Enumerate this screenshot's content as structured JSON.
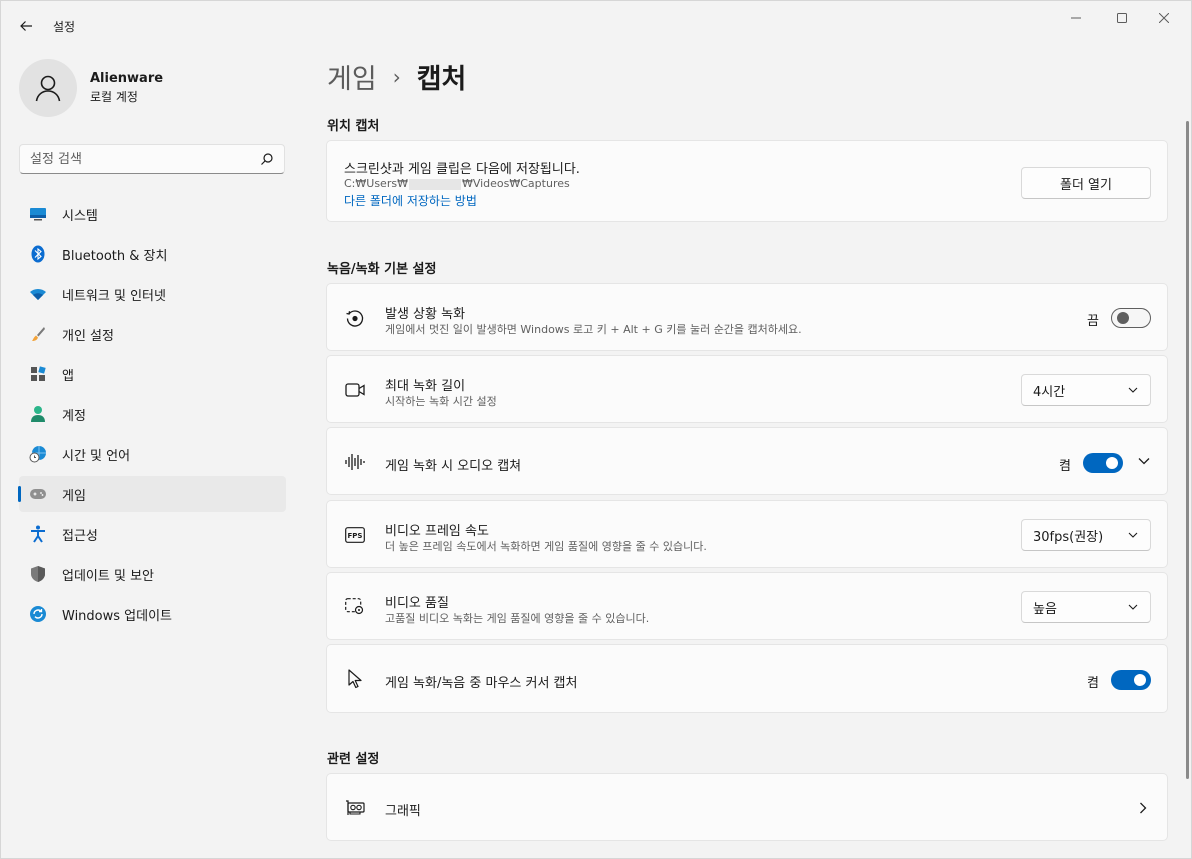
{
  "window": {
    "app_title": "설정"
  },
  "profile": {
    "name": "Alienware",
    "account_type": "로컬 계정"
  },
  "search": {
    "placeholder": "설정 검색"
  },
  "sidebar": {
    "items": [
      {
        "label": "시스템",
        "icon": "system-icon"
      },
      {
        "label": "Bluetooth & 장치",
        "icon": "bluetooth-icon"
      },
      {
        "label": "네트워크 및 인터넷",
        "icon": "wifi-icon"
      },
      {
        "label": "개인 설정",
        "icon": "brush-icon"
      },
      {
        "label": "앱",
        "icon": "apps-icon"
      },
      {
        "label": "계정",
        "icon": "account-icon"
      },
      {
        "label": "시간 및 언어",
        "icon": "globe-clock-icon"
      },
      {
        "label": "게임",
        "icon": "gamepad-icon",
        "active": true
      },
      {
        "label": "접근성",
        "icon": "accessibility-icon"
      },
      {
        "label": "업데이트 및 보안",
        "icon": "shield-icon"
      },
      {
        "label": "Windows 업데이트",
        "icon": "update-icon"
      }
    ]
  },
  "breadcrumb": {
    "parent": "게임",
    "separator": "›",
    "current": "캡처"
  },
  "capture_location": {
    "section_title": "위치 캡처",
    "title": "스크린샷과 게임 클립은 다음에 저장됩니다.",
    "path_prefix": "C:₩Users₩",
    "path_suffix": "₩Videos₩Captures",
    "link": "다른 폴더에 저장하는 방법",
    "button": "폴더 열기"
  },
  "recording": {
    "section_title": "녹음/녹화 기본 설정",
    "background_recording": {
      "title": "발생 상황 녹화",
      "desc": "게임에서 멋진 일이 발생하면 Windows 로고 키 + Alt + G 키를 눌러 순간을 캡처하세요.",
      "state_label": "끔",
      "on": false
    },
    "max_length": {
      "title": "최대 녹화 길이",
      "desc": "시작하는 녹화 시간 설정",
      "value": "4시간"
    },
    "audio_capture": {
      "title": "게임 녹화 시 오디오 캡쳐",
      "state_label": "켬",
      "on": true
    },
    "frame_rate": {
      "title": "비디오 프레임 속도",
      "desc": "더 높은 프레임 속도에서 녹화하면 게임 품질에 영향을 줄 수 있습니다.",
      "value": "30fps(권장)"
    },
    "video_quality": {
      "title": "비디오 품질",
      "desc": "고품질 비디오 녹화는 게임 품질에 영향을 줄 수 있습니다.",
      "value": "높음"
    },
    "mouse_cursor": {
      "title": "게임 녹화/녹음 중 마우스 커서 캡처",
      "state_label": "켬",
      "on": true
    }
  },
  "related": {
    "section_title": "관련 설정",
    "graphics": {
      "title": "그래픽"
    }
  },
  "colors": {
    "accent": "#0067c0",
    "background": "#f3f3f3",
    "card": "#fbfbfb"
  }
}
